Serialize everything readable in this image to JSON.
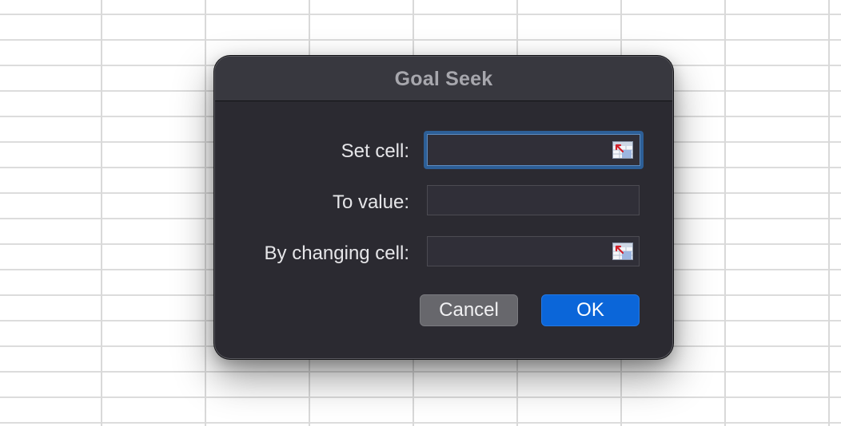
{
  "dialog": {
    "title": "Goal Seek",
    "fields": [
      {
        "label": "Set cell:",
        "value": "",
        "focused": true,
        "has_ref_picker": true,
        "ref_icon": "range-select-icon"
      },
      {
        "label": "To value:",
        "value": "",
        "focused": false,
        "has_ref_picker": false
      },
      {
        "label": "By changing cell:",
        "value": "",
        "focused": false,
        "has_ref_picker": true,
        "ref_icon": "range-select-icon"
      }
    ],
    "buttons": {
      "cancel": "Cancel",
      "ok": "OK"
    }
  },
  "colors": {
    "dialog_bg": "#2b2a31",
    "titlebar_bg": "#38383f",
    "focus_ring": "#2d5f97",
    "primary_button": "#0b66d9",
    "secondary_button": "#67676c"
  }
}
